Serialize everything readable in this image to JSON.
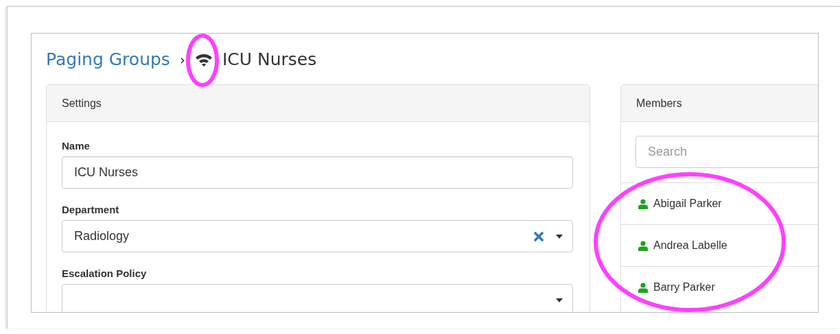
{
  "breadcrumb": {
    "parent": "Paging Groups",
    "separator": "›",
    "current": "ICU Nurses"
  },
  "settings": {
    "title": "Settings",
    "fields": [
      {
        "kind": "text",
        "label": "Name",
        "value": "ICU Nurses"
      },
      {
        "kind": "select",
        "label": "Department",
        "value": "Radiology",
        "clearable": true
      },
      {
        "kind": "select",
        "label": "Escalation Policy",
        "clearable": false
      }
    ]
  },
  "members": {
    "title": "Members",
    "search": {
      "placeholder": "Search"
    },
    "items": [
      {
        "name": "Abigail Parker"
      },
      {
        "name": "Andrea Labelle"
      },
      {
        "name": "Barry Parker"
      }
    ]
  }
}
